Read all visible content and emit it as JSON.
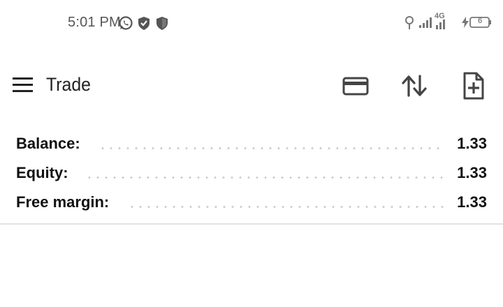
{
  "status_bar": {
    "time": "5:01 PM",
    "left_icons": [
      "whatsapp-icon",
      "shield-check-icon",
      "shield-icon"
    ],
    "network": "4G",
    "battery": "6"
  },
  "toolbar": {
    "title": "Trade",
    "actions": [
      "credit-card-icon",
      "sort-arrows-icon",
      "new-document-icon"
    ]
  },
  "account": {
    "rows": [
      {
        "label": "Balance:",
        "value": "1.33"
      },
      {
        "label": "Equity:",
        "value": "1.33"
      },
      {
        "label": "Free margin:",
        "value": "1.33"
      }
    ]
  },
  "colors": {
    "text": "#111111",
    "icon": "#444444",
    "status_text": "#555555",
    "dots": "#c8c8c8",
    "divider": "#e2e2e2"
  }
}
